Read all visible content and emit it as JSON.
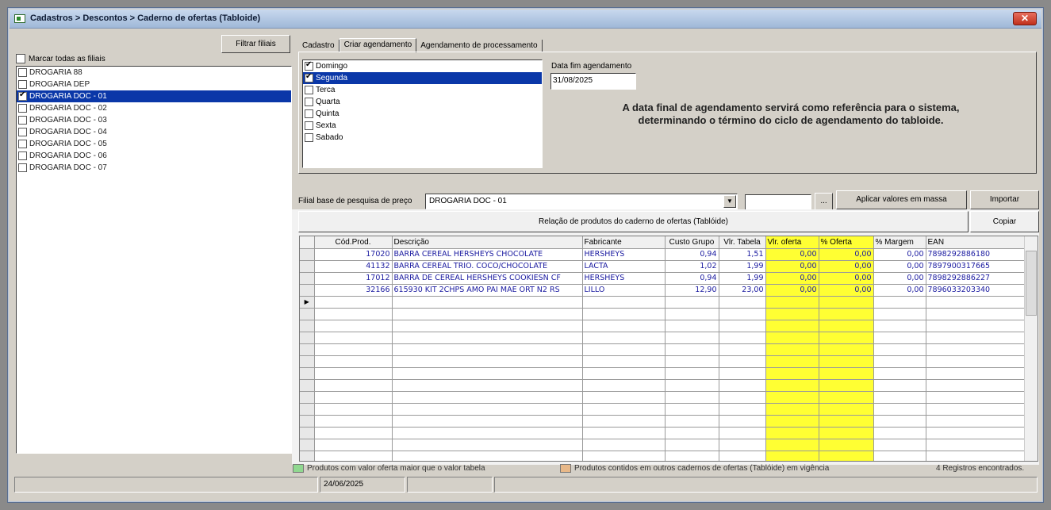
{
  "window": {
    "title": "Cadastros > Descontos > Caderno de ofertas (Tabloide)",
    "close_label": "✕"
  },
  "left": {
    "filtrar_label": "Filtrar filiais",
    "marcar_label": "Marcar todas as filiais",
    "filiais": [
      {
        "name": "DROGARIA 88",
        "checked": false,
        "selected": false
      },
      {
        "name": "DROGARIA DEP",
        "checked": false,
        "selected": false
      },
      {
        "name": "DROGARIA DOC - 01",
        "checked": true,
        "selected": true
      },
      {
        "name": "DROGARIA DOC - 02",
        "checked": false,
        "selected": false
      },
      {
        "name": "DROGARIA DOC - 03",
        "checked": false,
        "selected": false
      },
      {
        "name": "DROGARIA DOC - 04",
        "checked": false,
        "selected": false
      },
      {
        "name": "DROGARIA DOC - 05",
        "checked": false,
        "selected": false
      },
      {
        "name": "DROGARIA DOC - 06",
        "checked": false,
        "selected": false
      },
      {
        "name": "DROGARIA DOC - 07",
        "checked": false,
        "selected": false
      }
    ]
  },
  "tabs": [
    "Cadastro",
    "Criar agendamento",
    "Agendamento de processamento"
  ],
  "active_tab": 1,
  "agendamento": {
    "dias": [
      {
        "label": "Domingo",
        "checked": true,
        "selected": false
      },
      {
        "label": "Segunda",
        "checked": true,
        "selected": true
      },
      {
        "label": "Terca",
        "checked": false,
        "selected": false
      },
      {
        "label": "Quarta",
        "checked": false,
        "selected": false
      },
      {
        "label": "Quinta",
        "checked": false,
        "selected": false
      },
      {
        "label": "Sexta",
        "checked": false,
        "selected": false
      },
      {
        "label": "Sabado",
        "checked": false,
        "selected": false
      }
    ],
    "data_fim_label": "Data fim agendamento",
    "data_fim_value": "31/08/2025",
    "info_line1": "A data final de agendamento servirá como referência para o sistema,",
    "info_line2": "determinando o término do ciclo de agendamento do tabloide."
  },
  "filial_base": {
    "label": "Filial base de pesquisa de preço",
    "value": "DROGARIA DOC - 01",
    "dropdown_arrow": "▼",
    "search_value": ""
  },
  "buttons": {
    "ellipsis": "...",
    "aplicar": "Aplicar valores em massa",
    "importar": "Importar",
    "copiar": "Copiar"
  },
  "relacao_label": "Relação de produtos do caderno de ofertas (Tablóide)",
  "grid": {
    "columns": [
      "Cód.Prod.",
      "Descrição",
      "Fabricante",
      "Custo Grupo",
      "Vlr. Tabela",
      "Vlr. oferta",
      "% Oferta",
      "% Margem",
      "EAN"
    ],
    "rows": [
      [
        "17020",
        "BARRA CEREAL HERSHEYS CHOCOLATE",
        "HERSHEYS",
        "0,94",
        "1,51",
        "0,00",
        "0,00",
        "0,00",
        "7898292886180"
      ],
      [
        "41132",
        "BARRA CEREAL TRIO. COCO/CHOCOLATE",
        "LACTA",
        "1,02",
        "1,99",
        "0,00",
        "0,00",
        "0,00",
        "7897900317665"
      ],
      [
        "17012",
        "BARRA DE CEREAL HERSHEYS COOKIESN CF",
        "HERSHEYS",
        "0,94",
        "1,99",
        "0,00",
        "0,00",
        "0,00",
        "7898292886227"
      ],
      [
        "32166",
        "615930 KIT 2CHPS AMO PAI  MAE ORT N2 RS",
        "LILLO",
        "12,90",
        "23,00",
        "0,00",
        "0,00",
        "0,00",
        "7896033203340"
      ]
    ],
    "empty_rows": 14,
    "row_indicator": "▶"
  },
  "legend": {
    "green_label": "Produtos com valor oferta maior que o valor tabela",
    "green_color": "#90d890",
    "orange_label": "Produtos contidos em outros cadernos de ofertas (Tablóide) em vigência",
    "orange_color": "#e8b888",
    "registros": "4 Registros encontrados."
  },
  "status": {
    "date": "24/06/2025"
  },
  "colors": {
    "selection": "#0a37a8",
    "highlight_yellow": "#ffff33",
    "grid_text": "#1a1aa0"
  }
}
